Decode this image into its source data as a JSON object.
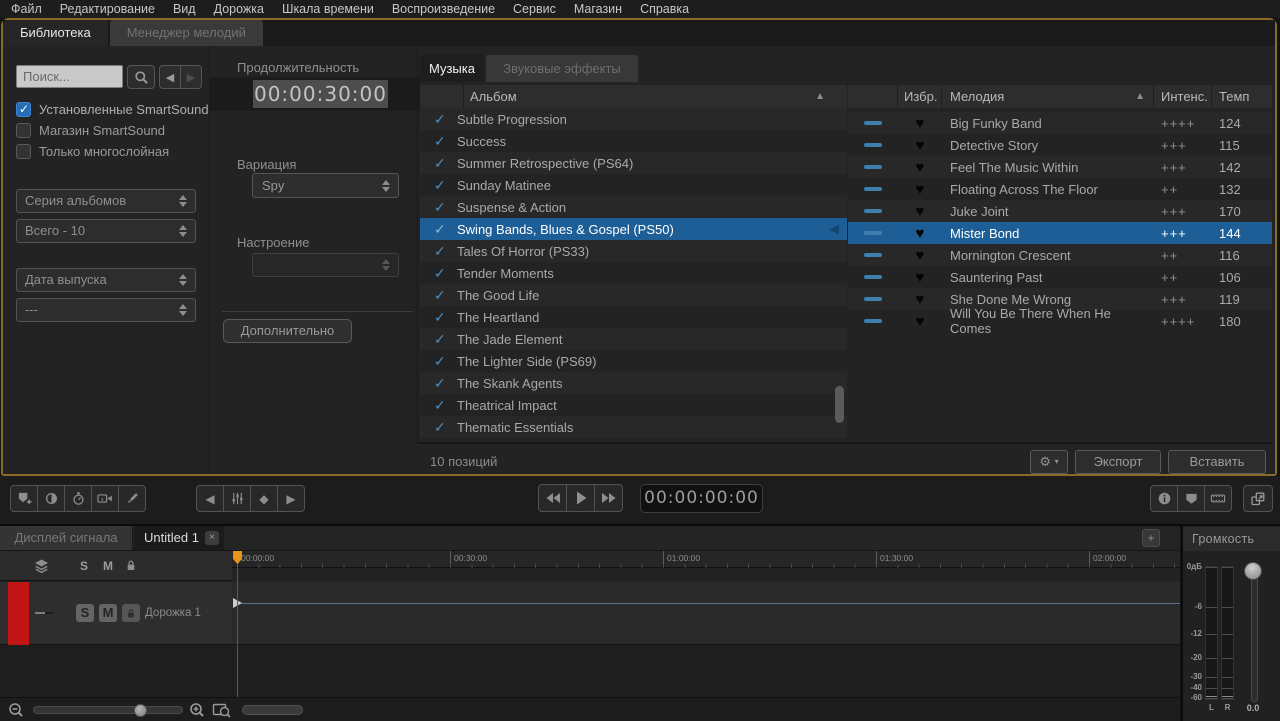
{
  "colors": {
    "selection_blue": "#1d5e96",
    "check_blue": "#4790c8",
    "dash_blue": "#3f7fae",
    "window_border_gold": "#8a6b28",
    "playhead_orange": "#e8951e",
    "track_red": "#c11414"
  },
  "menu": {
    "items": [
      "Файл",
      "Редактирование",
      "Вид",
      "Дорожка",
      "Шкала времени",
      "Воспроизведение",
      "Сервис",
      "Магазин",
      "Справка"
    ]
  },
  "library": {
    "tabs": {
      "library": "Библиотека",
      "melody_manager": "Менеджер мелодий"
    },
    "sidebar": {
      "search_placeholder": "Поиск...",
      "checkboxes": [
        {
          "label": "Установленные SmartSound",
          "checked": true
        },
        {
          "label": "Магазин SmartSound",
          "checked": false
        },
        {
          "label": "Только многослойная",
          "checked": false
        }
      ],
      "album_series": "Серия альбомов",
      "album_total": "Всего - 10",
      "release_date": "Дата выпуска",
      "release_date_value": "---"
    },
    "params": {
      "duration_label": "Продолжительность",
      "duration_value": "00:00:30:00",
      "variation_label": "Вариация",
      "variation_value": "Spy",
      "mood_label": "Настроение",
      "mood_value": "",
      "advanced_button": "Дополнительно"
    },
    "catalog_tabs": {
      "music": "Музыка",
      "sfx": "Звуковые эффекты"
    },
    "albums": {
      "header": "Альбом",
      "items": [
        {
          "name": "Subtle Progression",
          "selected": false
        },
        {
          "name": "Success",
          "selected": false
        },
        {
          "name": "Summer Retrospective (PS64)",
          "selected": false
        },
        {
          "name": "Sunday Matinee",
          "selected": false
        },
        {
          "name": "Suspense & Action",
          "selected": false
        },
        {
          "name": "Swing Bands, Blues & Gospel (PS50)",
          "selected": true
        },
        {
          "name": "Tales Of Horror (PS33)",
          "selected": false
        },
        {
          "name": "Tender Moments",
          "selected": false
        },
        {
          "name": "The Good Life",
          "selected": false
        },
        {
          "name": "The Heartland",
          "selected": false
        },
        {
          "name": "The Jade Element",
          "selected": false
        },
        {
          "name": "The Lighter Side (PS69)",
          "selected": false
        },
        {
          "name": "The Skank Agents",
          "selected": false
        },
        {
          "name": "Theatrical Impact",
          "selected": false
        },
        {
          "name": "Thematic Essentials",
          "selected": false
        }
      ]
    },
    "tunes": {
      "headers": {
        "favorite": "Избр.",
        "melody": "Мелодия",
        "intensity": "Интенс.",
        "tempo": "Темп"
      },
      "rows": [
        {
          "name": "Big Funky Band",
          "intensity": "++++",
          "tempo": "124",
          "selected": false
        },
        {
          "name": "Detective Story",
          "intensity": "+++",
          "tempo": "115",
          "selected": false
        },
        {
          "name": "Feel The Music Within",
          "intensity": "+++",
          "tempo": "142",
          "selected": false
        },
        {
          "name": "Floating Across The Floor",
          "intensity": "++",
          "tempo": "132",
          "selected": false
        },
        {
          "name": "Juke Joint",
          "intensity": "+++",
          "tempo": "170",
          "selected": false
        },
        {
          "name": "Mister Bond",
          "intensity": "+++",
          "tempo": "144",
          "selected": true
        },
        {
          "name": "Mornington Crescent",
          "intensity": "++",
          "tempo": "116",
          "selected": false
        },
        {
          "name": "Sauntering Past",
          "intensity": "++",
          "tempo": "106",
          "selected": false
        },
        {
          "name": "She Done Me Wrong",
          "intensity": "+++",
          "tempo": "119",
          "selected": false
        },
        {
          "name": "Will You Be There When He Comes",
          "intensity": "++++",
          "tempo": "180",
          "selected": false
        }
      ]
    },
    "status_text": "10 позиций",
    "actions": {
      "export": "Экспорт",
      "insert": "Вставить"
    }
  },
  "transport": {
    "timecode": "00:00:00:00"
  },
  "timeline": {
    "tabs": {
      "signal_display": "Дисплей сигнала",
      "project": "Untitled 1"
    },
    "ruler_labels": [
      "00:00:00",
      "00:30:00",
      "01:00:00",
      "01:30:00",
      "02:00:00"
    ],
    "header": {
      "solo": "S",
      "mute": "M"
    },
    "track": {
      "name": "Дорожка 1",
      "solo": "S",
      "mute": "M"
    }
  },
  "volume": {
    "title": "Громкость",
    "scale": [
      "0дБ",
      "-6",
      "-12",
      "-20",
      "-30",
      "-40",
      "-60"
    ],
    "channel_left": "L",
    "channel_right": "R",
    "value": "0.0"
  }
}
